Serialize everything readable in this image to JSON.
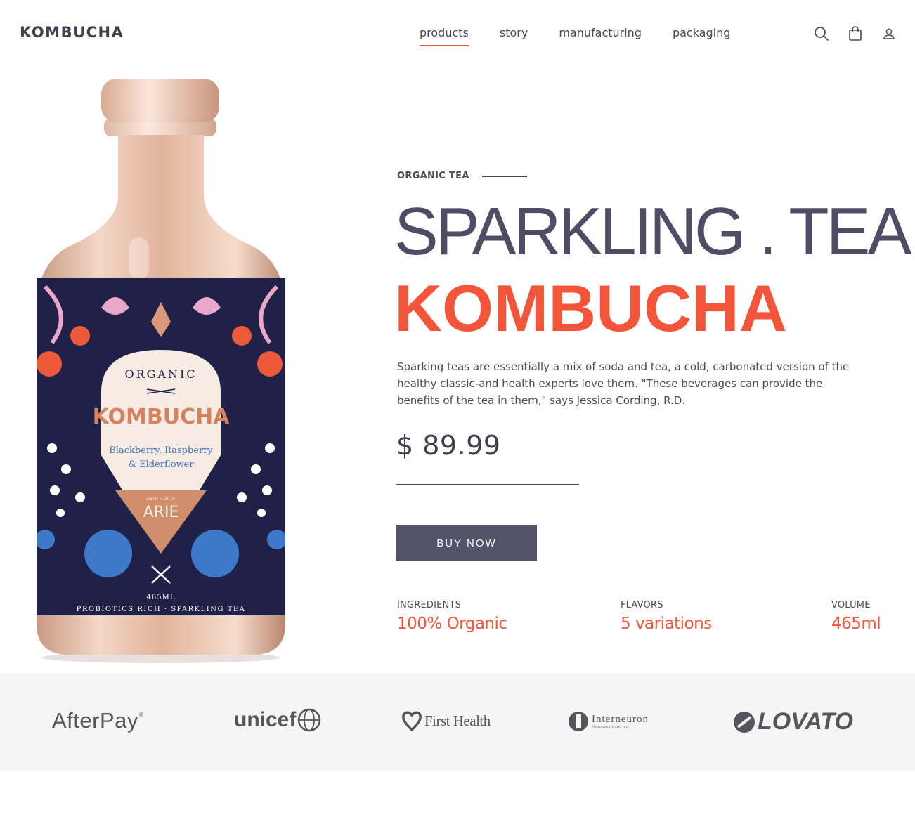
{
  "brand": {
    "logo": "KOMBUCHA"
  },
  "nav": {
    "items": [
      {
        "label": "products",
        "active": true
      },
      {
        "label": "story",
        "active": false
      },
      {
        "label": "manufacturing",
        "active": false
      },
      {
        "label": "packaging",
        "active": false
      }
    ]
  },
  "header_icons": [
    "search-icon",
    "shopping-bag-icon",
    "user-icon"
  ],
  "product_image": {
    "label_top": "ORGANIC",
    "label_brand": "KOMBUCHA",
    "label_flavor_line1": "Blackberry, Raspberry",
    "label_flavor_line2": "& Elderflower",
    "label_estd": "ESTD ∞ 2019",
    "label_maker": "ARIE",
    "label_volume": "465ML",
    "label_bottom": "PROBIOTICS RICH · SPARKLING TEA"
  },
  "hero": {
    "eyebrow": "ORGANIC TEA",
    "title_line1": "SPARKLING . TEA",
    "title_line2": "KOMBUCHA",
    "description": "Sparking teas are essentially a mix of soda and tea, a cold, carbonated version of the healthy classic-and health experts love them. \"These beverages can provide the benefits of the tea in them,\" says Jessica Cording, R.D.",
    "price": "$ 89.99",
    "buy_label": "BUY NOW"
  },
  "specs": [
    {
      "label": "INGREDIENTS",
      "value": "100% Organic"
    },
    {
      "label": "FLAVORS",
      "value": "5 variations"
    },
    {
      "label": "VOLUME",
      "value": "465ml"
    }
  ],
  "partners": {
    "afterpay": "AfterPay",
    "unicef": "unicef",
    "firsthealth": "First Health",
    "interneuron": "Interneuron",
    "interneuron_sub": "Pharmaceuticals, Inc.",
    "lovato": "LOVATO"
  },
  "colors": {
    "accent": "#f2553a",
    "dark": "#4f4d63",
    "button": "#55536a",
    "partners_bg": "#f5f5f5"
  }
}
